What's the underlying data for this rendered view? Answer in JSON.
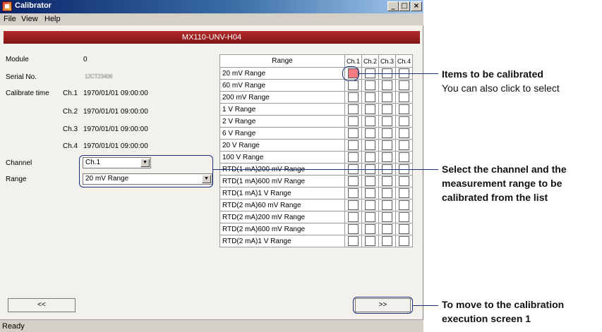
{
  "window": {
    "title": "Calibrator",
    "menu": [
      "File",
      "View",
      "Help"
    ],
    "header": "MX110-UNV-H04",
    "status": "Ready"
  },
  "info": {
    "module_label": "Module",
    "module_value": "0",
    "serial_label": "Serial No.",
    "serial_value": "12CT23406",
    "calib_label": "Calibrate time",
    "calib_rows": [
      {
        "ch": "Ch.1",
        "time": "1970/01/01 09:00:00"
      },
      {
        "ch": "Ch.2",
        "time": "1970/01/01 09:00:00"
      },
      {
        "ch": "Ch.3",
        "time": "1970/01/01 09:00:00"
      },
      {
        "ch": "Ch.4",
        "time": "1970/01/01 09:00:00"
      }
    ],
    "channel_label": "Channel",
    "channel_value": "Ch.1",
    "range_label": "Range",
    "range_value": "20 mV Range"
  },
  "table": {
    "header": "Range",
    "channels": [
      "Ch.1",
      "Ch.2",
      "Ch.3",
      "Ch.4"
    ],
    "rows": [
      {
        "name": "20 mV Range",
        "checked": [
          true,
          false,
          false,
          false
        ]
      },
      {
        "name": "60 mV Range",
        "checked": [
          false,
          false,
          false,
          false
        ]
      },
      {
        "name": "200 mV Range",
        "checked": [
          false,
          false,
          false,
          false
        ]
      },
      {
        "name": "1 V Range",
        "checked": [
          false,
          false,
          false,
          false
        ]
      },
      {
        "name": "2 V Range",
        "checked": [
          false,
          false,
          false,
          false
        ]
      },
      {
        "name": "6 V Range",
        "checked": [
          false,
          false,
          false,
          false
        ]
      },
      {
        "name": "20 V Range",
        "checked": [
          false,
          false,
          false,
          false
        ]
      },
      {
        "name": "100 V Range",
        "checked": [
          false,
          false,
          false,
          false
        ]
      },
      {
        "name": "RTD(1 mA)200 mV Range",
        "checked": [
          false,
          false,
          false,
          false
        ]
      },
      {
        "name": "RTD(1 mA)600 mV Range",
        "checked": [
          false,
          false,
          false,
          false
        ]
      },
      {
        "name": "RTD(1 mA)1 V Range",
        "checked": [
          false,
          false,
          false,
          false
        ]
      },
      {
        "name": "RTD(2 mA)60 mV Range",
        "checked": [
          false,
          false,
          false,
          false
        ]
      },
      {
        "name": "RTD(2 mA)200 mV Range",
        "checked": [
          false,
          false,
          false,
          false
        ]
      },
      {
        "name": "RTD(2 mA)600 mV Range",
        "checked": [
          false,
          false,
          false,
          false
        ]
      },
      {
        "name": "RTD(2 mA)1 V Range",
        "checked": [
          false,
          false,
          false,
          false
        ]
      }
    ]
  },
  "buttons": {
    "back": "<<",
    "next": ">>"
  },
  "annotations": {
    "items_title": "Items to be calibrated",
    "items_sub": "You can also click to select",
    "select_line1": "Select the channel and the",
    "select_line2": "measurement range to be",
    "select_line3": "calibrated from the list",
    "move_line1": "To move to the calibration",
    "move_line2": "execution screen 1"
  },
  "colors": {
    "header_band": "#a12222",
    "checked": "#f27b84",
    "callout": "#1f2f80"
  }
}
